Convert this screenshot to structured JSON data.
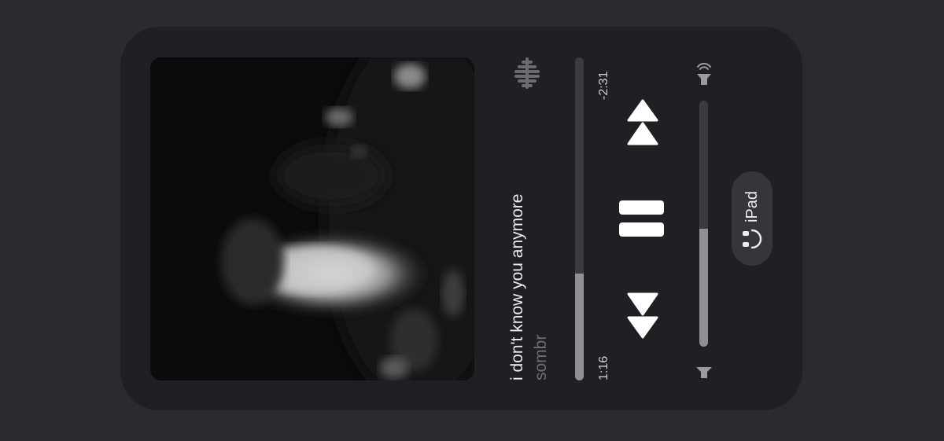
{
  "now_playing": {
    "title": "i don't know you anymore",
    "artist": "sombr",
    "elapsed": "1:16",
    "remaining": "-2:31",
    "progress": 0.33
  },
  "controls": {
    "airplay_icon": "airplay-waveform-icon",
    "previous_icon": "backward-icon",
    "play_pause_icon": "pause-icon",
    "next_icon": "forward-icon"
  },
  "volume": {
    "level": 0.48,
    "high_icon": "speaker-high-icon",
    "low_icon": "speaker-low-icon"
  },
  "output_device": {
    "label": "iPad",
    "icon": "headphones-icon"
  },
  "colors": {
    "background": "#2b2b2f",
    "panel": "#1f2023",
    "text_primary": "#ededed",
    "text_secondary": "#6e6f74",
    "track": "#3a3b40",
    "track_fill": "#8f9096"
  }
}
